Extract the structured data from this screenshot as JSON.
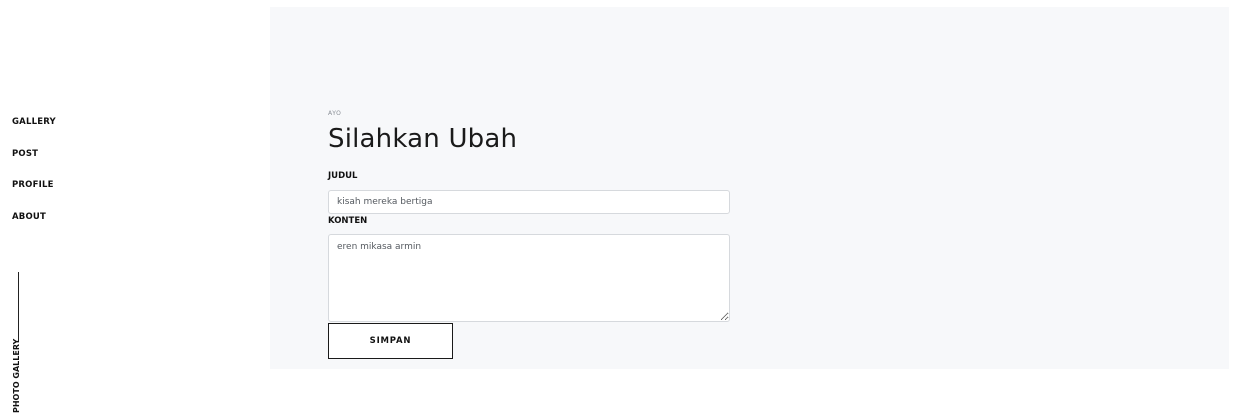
{
  "sidebar": {
    "items": [
      {
        "label": "GALLERY"
      },
      {
        "label": "POST"
      },
      {
        "label": "PROFILE"
      },
      {
        "label": "ABOUT"
      }
    ],
    "vertical_label": "PHOTO GALLERY"
  },
  "form": {
    "eyebrow": "AYO",
    "title": "Silahkan Ubah",
    "judul_label": "JUDUL",
    "judul_value": "kisah mereka bertiga",
    "konten_label": "KONTEN",
    "konten_value": "eren mikasa armin",
    "save_label": "SIMPAN"
  },
  "colors": {
    "panel_background": "#f7f8fa",
    "text": "#111111",
    "border": "#d6d9dd"
  }
}
